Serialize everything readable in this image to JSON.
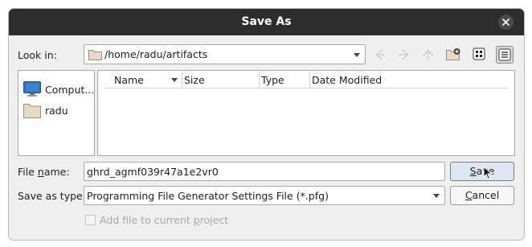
{
  "window": {
    "title": "Save As"
  },
  "look_in": {
    "label": "Look in:",
    "path": "/home/radu/artifacts"
  },
  "sidebar": {
    "items": [
      {
        "label": "Comput...",
        "icon": "computer-icon"
      },
      {
        "label": "radu",
        "icon": "folder-icon"
      }
    ]
  },
  "file_list": {
    "columns": [
      "Name",
      "Size",
      "Type",
      "Date Modified"
    ],
    "rows": []
  },
  "file_name": {
    "label_prefix": "File ",
    "label_mnemonic": "n",
    "label_suffix": "ame:",
    "value": "ghrd_agmf039r47a1e2vr0"
  },
  "save_as_type": {
    "label": "Save as type:",
    "value": "Programming File Generator Settings File (*.pfg)"
  },
  "buttons": {
    "save": {
      "mnemonic": "S",
      "rest": "ave"
    },
    "cancel": {
      "mnemonic": "C",
      "rest": "ancel"
    }
  },
  "add_to_project": {
    "label_prefix": "Add file to current ",
    "label_mnemonic": "p",
    "label_suffix": "roject",
    "checked": false,
    "enabled": false
  },
  "colors": {
    "titlebar": "#2d2d2d",
    "dialog_bg": "#efefef",
    "folder": "#e8d9c4"
  }
}
